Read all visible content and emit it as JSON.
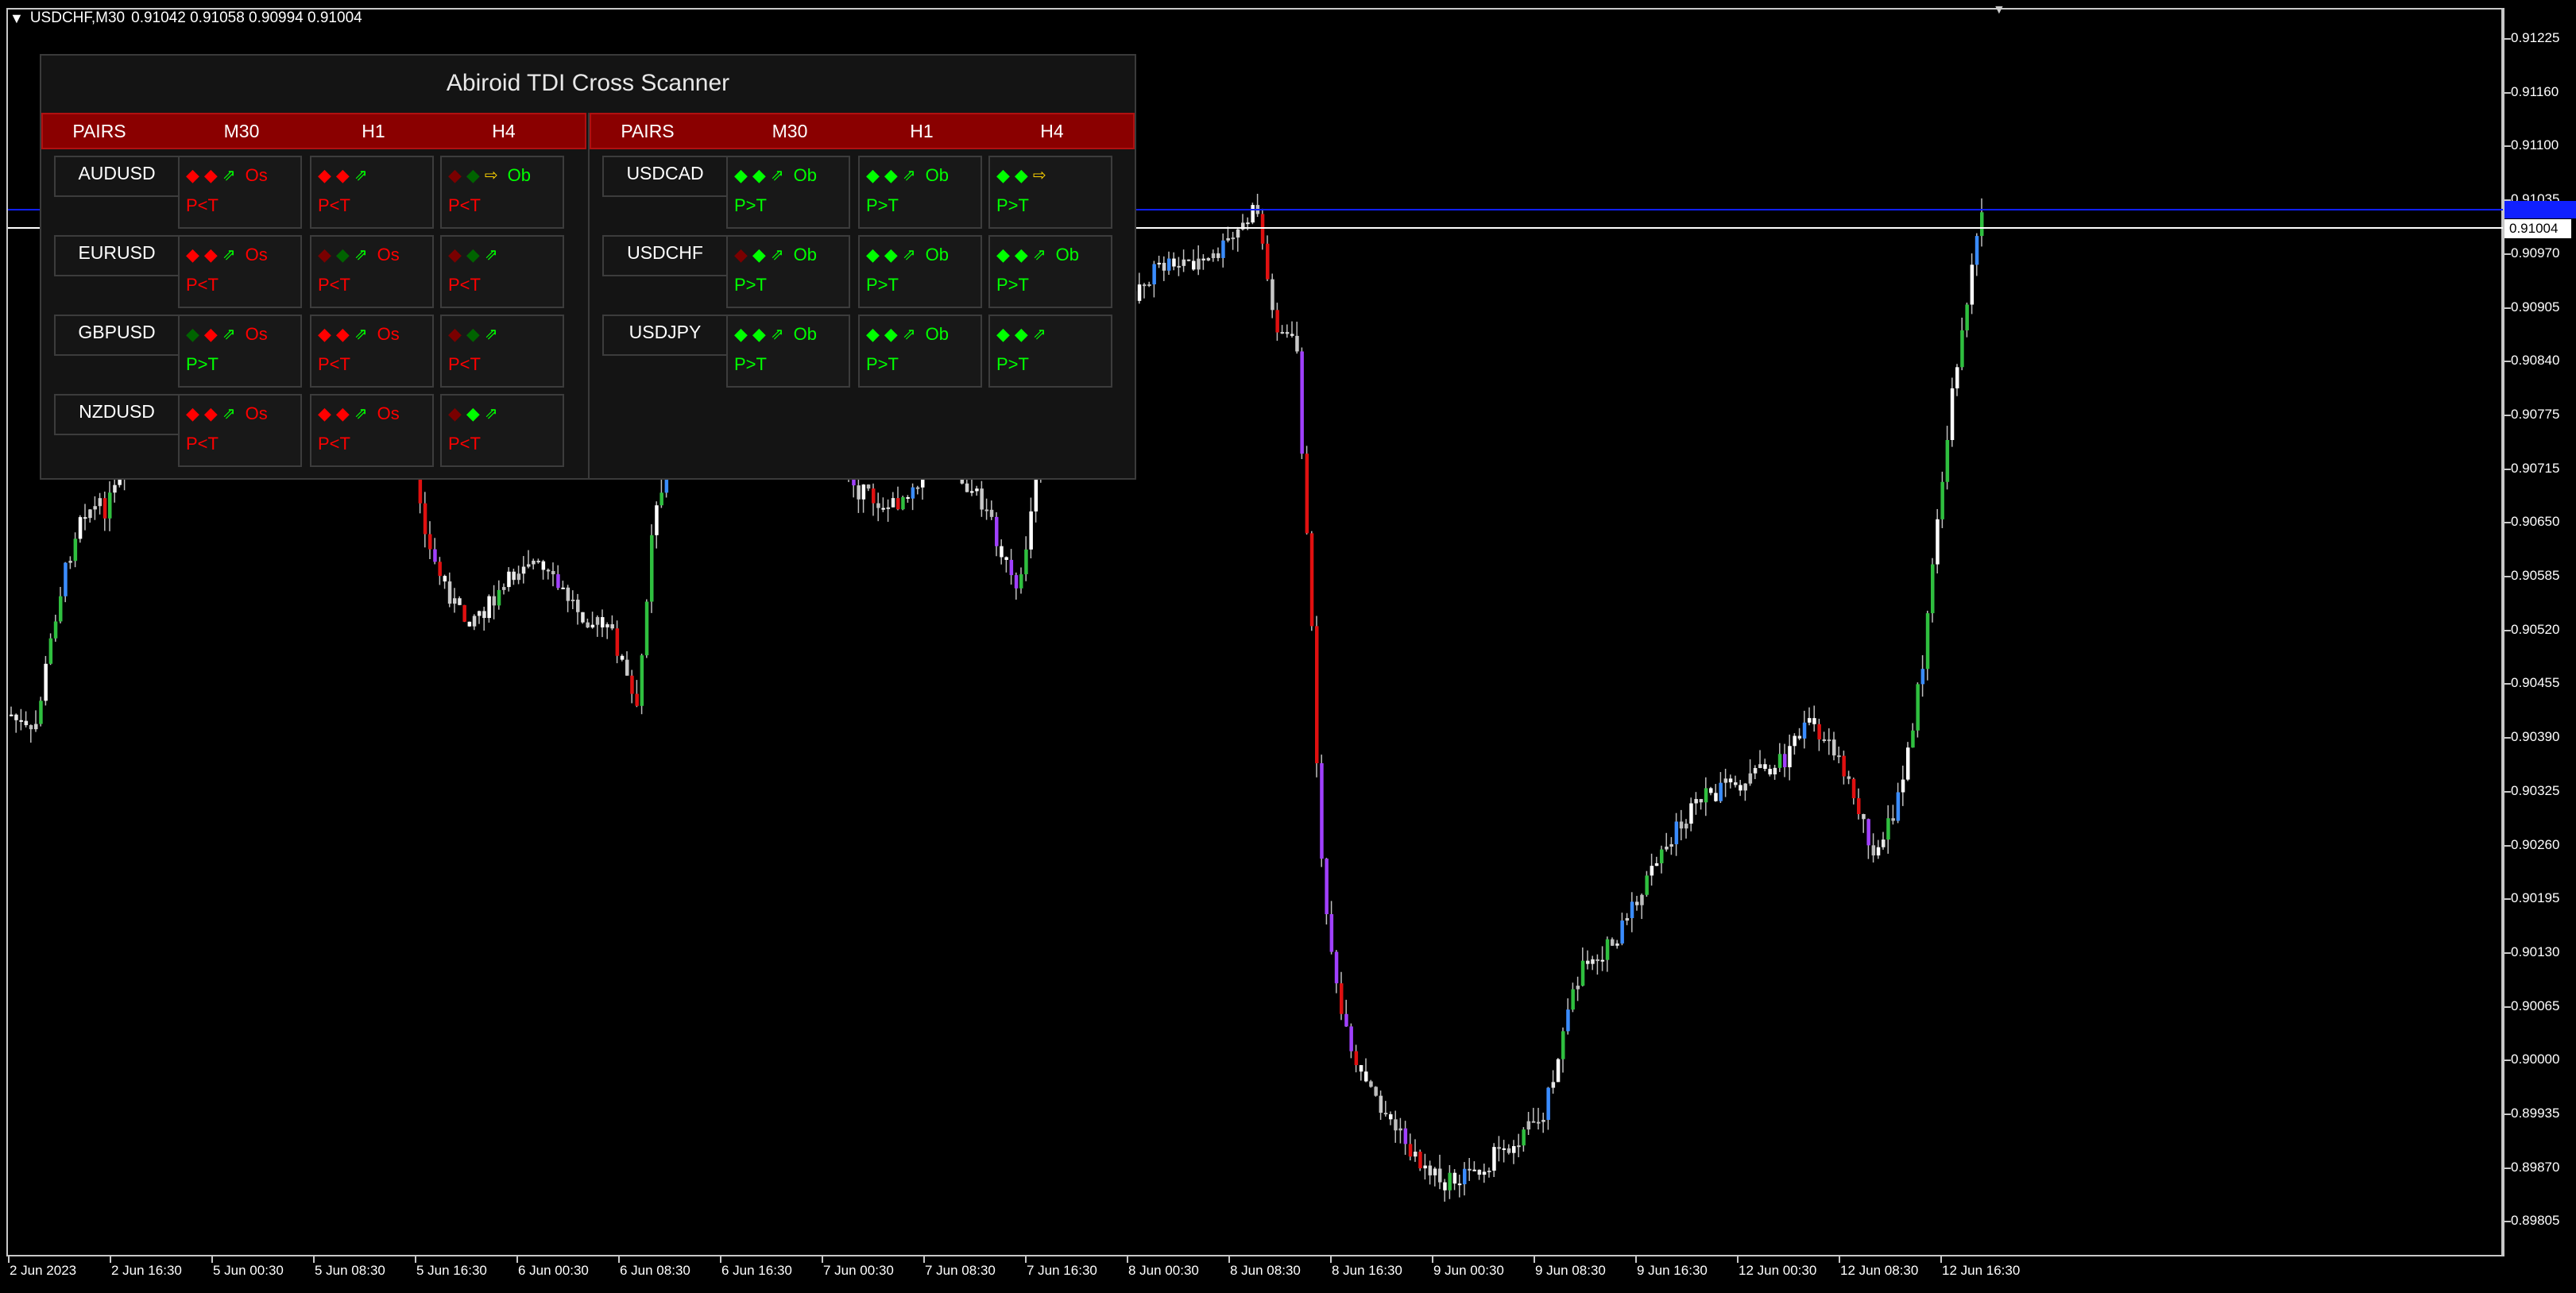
{
  "header": {
    "symbol_timeframe": "USDCHF,M30",
    "ohlc": "0.91042 0.91058 0.90994 0.91004"
  },
  "price_axis": {
    "labels": [
      "0.91225",
      "0.91160",
      "0.91100",
      "0.91035",
      "0.90970",
      "0.90905",
      "0.90840",
      "0.90775",
      "0.90715",
      "0.90650",
      "0.90585",
      "0.90520",
      "0.90455",
      "0.90390",
      "0.90325",
      "0.90260",
      "0.90195",
      "0.90130",
      "0.90065",
      "0.90000",
      "0.89935",
      "0.89870",
      "0.89805"
    ],
    "bid_label": "0.91004"
  },
  "time_axis": {
    "labels": [
      "2 Jun 2023",
      "2 Jun 16:30",
      "5 Jun 00:30",
      "5 Jun 08:30",
      "5 Jun 16:30",
      "6 Jun 00:30",
      "6 Jun 08:30",
      "6 Jun 16:30",
      "7 Jun 00:30",
      "7 Jun 08:30",
      "7 Jun 16:30",
      "8 Jun 00:30",
      "8 Jun 08:30",
      "8 Jun 16:30",
      "9 Jun 00:30",
      "9 Jun 08:30",
      "9 Jun 16:30",
      "12 Jun 00:30",
      "12 Jun 08:30",
      "12 Jun 16:30"
    ]
  },
  "colors": {
    "bull": "#ffffff",
    "bear": "#c8c8c8",
    "red": "#ff0000",
    "dark_red": "#7a0000",
    "green": "#00ff00",
    "dark_green": "#006400",
    "yellow": "#ffd400",
    "header_bg": "#8a0000",
    "ask_line": "#1020ff",
    "bid_line": "#ffffff"
  },
  "scanner": {
    "title": "Abiroid TDI Cross Scanner",
    "columns": [
      "PAIRS",
      "M30",
      "H1",
      "H4"
    ],
    "left_rows": [
      {
        "pair": "AUDUSD",
        "cells": [
          {
            "d1": "red",
            "d2": "red",
            "arrow": "up",
            "arrow_color": "green",
            "zone": "Os",
            "zone_color": "red",
            "cross": "P<T",
            "cross_color": "red"
          },
          {
            "d1": "red",
            "d2": "red",
            "arrow": "up",
            "arrow_color": "green",
            "zone": "",
            "zone_color": "red",
            "cross": "P<T",
            "cross_color": "red"
          },
          {
            "d1": "dark_red",
            "d2": "dark_green",
            "arrow": "right",
            "arrow_color": "yellow",
            "zone": "Ob",
            "zone_color": "green",
            "cross": "P<T",
            "cross_color": "red"
          }
        ]
      },
      {
        "pair": "EURUSD",
        "cells": [
          {
            "d1": "red",
            "d2": "red",
            "arrow": "up",
            "arrow_color": "green",
            "zone": "Os",
            "zone_color": "red",
            "cross": "P<T",
            "cross_color": "red"
          },
          {
            "d1": "dark_red",
            "d2": "dark_green",
            "arrow": "up",
            "arrow_color": "green",
            "zone": "Os",
            "zone_color": "red",
            "cross": "P<T",
            "cross_color": "red"
          },
          {
            "d1": "dark_red",
            "d2": "dark_green",
            "arrow": "up",
            "arrow_color": "green",
            "zone": "",
            "zone_color": "red",
            "cross": "P<T",
            "cross_color": "red"
          }
        ]
      },
      {
        "pair": "GBPUSD",
        "cells": [
          {
            "d1": "dark_green",
            "d2": "red",
            "arrow": "up",
            "arrow_color": "green",
            "zone": "Os",
            "zone_color": "red",
            "cross": "P>T",
            "cross_color": "green"
          },
          {
            "d1": "red",
            "d2": "red",
            "arrow": "up",
            "arrow_color": "green",
            "zone": "Os",
            "zone_color": "red",
            "cross": "P<T",
            "cross_color": "red"
          },
          {
            "d1": "dark_red",
            "d2": "dark_green",
            "arrow": "up",
            "arrow_color": "green",
            "zone": "",
            "zone_color": "red",
            "cross": "P<T",
            "cross_color": "red"
          }
        ]
      },
      {
        "pair": "NZDUSD",
        "cells": [
          {
            "d1": "red",
            "d2": "red",
            "arrow": "up",
            "arrow_color": "green",
            "zone": "Os",
            "zone_color": "red",
            "cross": "P<T",
            "cross_color": "red"
          },
          {
            "d1": "red",
            "d2": "red",
            "arrow": "up",
            "arrow_color": "green",
            "zone": "Os",
            "zone_color": "red",
            "cross": "P<T",
            "cross_color": "red"
          },
          {
            "d1": "dark_red",
            "d2": "green",
            "arrow": "up",
            "arrow_color": "green",
            "zone": "",
            "zone_color": "red",
            "cross": "P<T",
            "cross_color": "red"
          }
        ]
      }
    ],
    "right_rows": [
      {
        "pair": "USDCAD",
        "cells": [
          {
            "d1": "green",
            "d2": "green",
            "arrow": "up",
            "arrow_color": "green",
            "zone": "Ob",
            "zone_color": "green",
            "cross": "P>T",
            "cross_color": "green"
          },
          {
            "d1": "green",
            "d2": "green",
            "arrow": "up",
            "arrow_color": "green",
            "zone": "Ob",
            "zone_color": "green",
            "cross": "P>T",
            "cross_color": "green"
          },
          {
            "d1": "green",
            "d2": "green",
            "arrow": "right",
            "arrow_color": "yellow",
            "zone": "",
            "zone_color": "green",
            "cross": "P>T",
            "cross_color": "green"
          }
        ]
      },
      {
        "pair": "USDCHF",
        "cells": [
          {
            "d1": "dark_red",
            "d2": "green",
            "arrow": "up",
            "arrow_color": "green",
            "zone": "Ob",
            "zone_color": "green",
            "cross": "P>T",
            "cross_color": "green"
          },
          {
            "d1": "green",
            "d2": "green",
            "arrow": "up",
            "arrow_color": "green",
            "zone": "Ob",
            "zone_color": "green",
            "cross": "P>T",
            "cross_color": "green"
          },
          {
            "d1": "green",
            "d2": "green",
            "arrow": "up",
            "arrow_color": "green",
            "zone": "Ob",
            "zone_color": "green",
            "cross": "P>T",
            "cross_color": "green"
          }
        ]
      },
      {
        "pair": "USDJPY",
        "cells": [
          {
            "d1": "green",
            "d2": "green",
            "arrow": "up",
            "arrow_color": "green",
            "zone": "Ob",
            "zone_color": "green",
            "cross": "P>T",
            "cross_color": "green"
          },
          {
            "d1": "green",
            "d2": "green",
            "arrow": "up",
            "arrow_color": "green",
            "zone": "Ob",
            "zone_color": "green",
            "cross": "P>T",
            "cross_color": "green"
          },
          {
            "d1": "green",
            "d2": "green",
            "arrow": "up",
            "arrow_color": "green",
            "zone": "",
            "zone_color": "green",
            "cross": "P>T",
            "cross_color": "green"
          }
        ]
      }
    ]
  }
}
